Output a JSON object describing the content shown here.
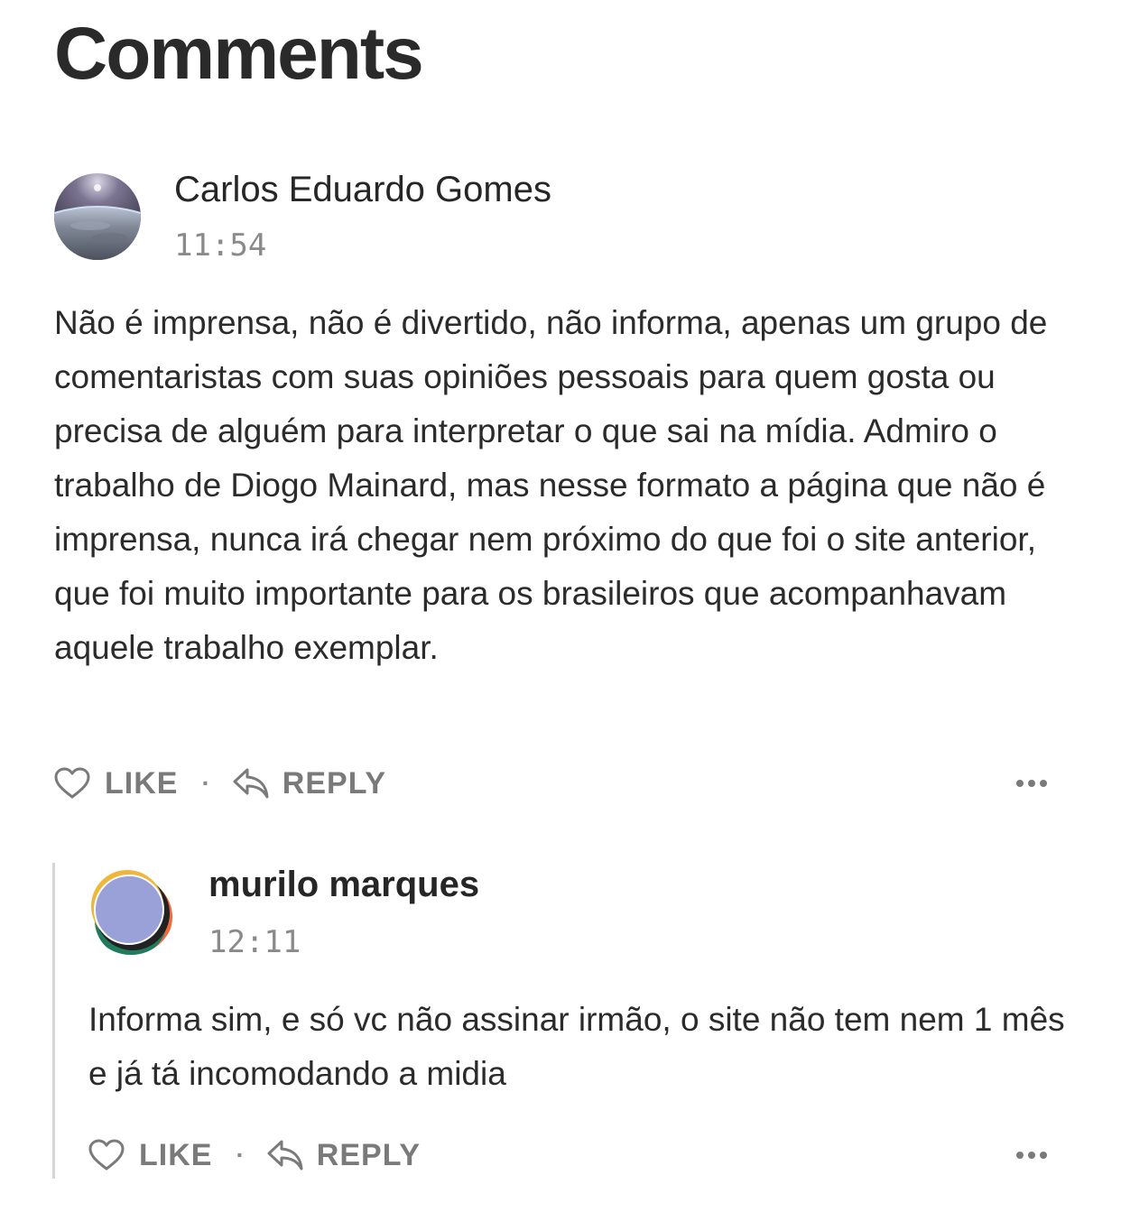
{
  "page": {
    "title": "Comments"
  },
  "comments": [
    {
      "author": "Carlos Eduardo Gomes",
      "time": "11:54",
      "text": "Não é imprensa, não é divertido, não informa, apenas um grupo de comentaristas com suas opiniões pessoais para quem gosta ou precisa de alguém para interpretar o que sai na mídia. Admiro o trabalho de Diogo Mainard, mas nesse formato a página que não é imprensa, nunca irá chegar nem próximo do que foi o site anterior, que foi muito importante para os brasileiros que acompanhavam aquele trabalho exemplar.",
      "like_label": "LIKE",
      "separator": "·",
      "reply_label": "REPLY",
      "avatar_icon": "earth-horizon-photo"
    },
    {
      "author": "murilo marques",
      "time": "12:11",
      "text": "Informa sim, e só vc não assinar irmão, o site não tem nem 1 mês e já tá incomodando a midia",
      "like_label": "LIKE",
      "separator": "·",
      "reply_label": "REPLY",
      "avatar_icon": "layered-circles-avatar"
    }
  ],
  "icons": {
    "like": "heart-icon",
    "reply": "reply-arrow-icon",
    "more": "more-dots-icon"
  },
  "colors": {
    "text": "#2b2b2b",
    "muted": "#7a7a7a",
    "thread_line": "#d6d6d6",
    "background": "#ffffff"
  }
}
